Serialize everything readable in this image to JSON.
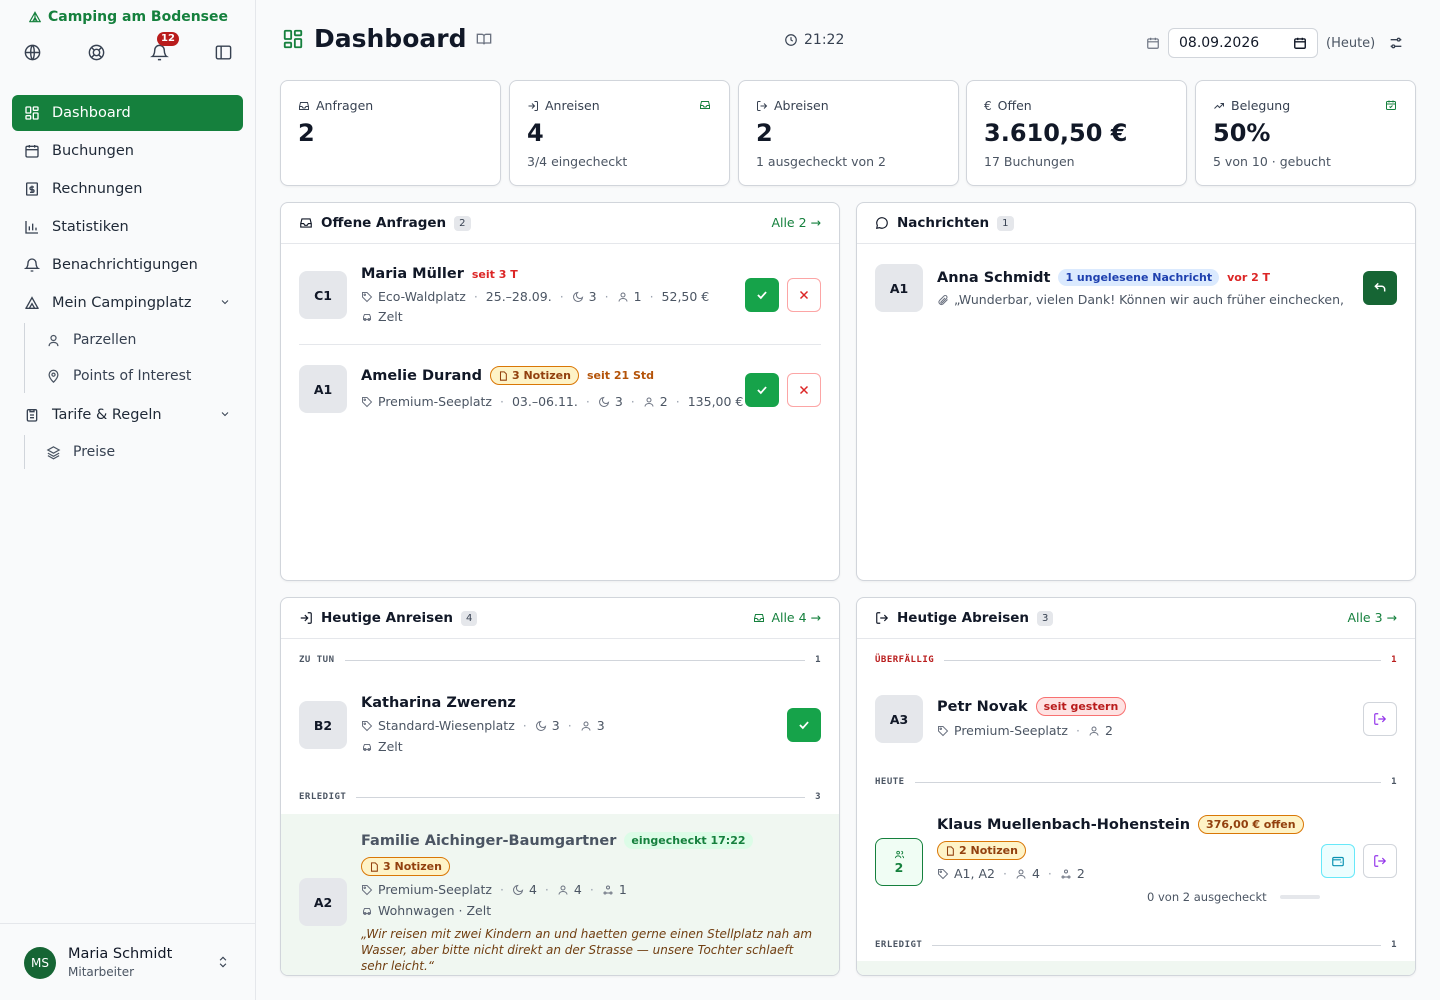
{
  "sidebar": {
    "brand": "Camping am Bodensee",
    "notifications_count": "12",
    "nav": {
      "dashboard": "Dashboard",
      "buchungen": "Buchungen",
      "rechnungen": "Rechnungen",
      "statistiken": "Statistiken",
      "benachrichtigungen": "Benachrichtigungen",
      "campingplatz": "Mein Campingplatz",
      "parzellen": "Parzellen",
      "poi": "Points of Interest",
      "tarife": "Tarife & Regeln",
      "preise": "Preise"
    },
    "user": {
      "initials": "MS",
      "name": "Maria Schmidt",
      "role": "Mitarbeiter"
    }
  },
  "header": {
    "title": "Dashboard",
    "time": "21:22",
    "date": "08.09.2026",
    "today": "(Heute)"
  },
  "stats": {
    "anfragen": {
      "label": "Anfragen",
      "value": "2"
    },
    "anreisen": {
      "label": "Anreisen",
      "value": "4",
      "sub": "3/4 eingecheckt"
    },
    "abreisen": {
      "label": "Abreisen",
      "value": "2",
      "sub": "1 ausgecheckt von 2"
    },
    "offen": {
      "label": "Offen",
      "value": "3.610,50 €",
      "sub": "17 Buchungen"
    },
    "belegung": {
      "label": "Belegung",
      "value": "50%",
      "sub": "5 von 10 · gebucht"
    }
  },
  "anfragen": {
    "title": "Offene Anfragen",
    "count": "2",
    "all": "Alle 2 →",
    "items": [
      {
        "code": "C1",
        "name": "Maria Müller",
        "since": "seit 3 T",
        "pitch": "Eco-Waldplatz",
        "dates": "25.–28.09.",
        "nights": "3",
        "persons": "1",
        "price": "52,50 €",
        "vehicle": "Zelt"
      },
      {
        "code": "A1",
        "name": "Amelie Durand",
        "notes": "3 Notizen",
        "since": "seit 21 Std",
        "pitch": "Premium-Seeplatz",
        "dates": "03.–06.11.",
        "nights": "3",
        "persons": "2",
        "price": "135,00 €"
      }
    ]
  },
  "nachrichten": {
    "title": "Nachrichten",
    "count": "1",
    "items": [
      {
        "code": "A1",
        "name": "Anna Schmidt",
        "unread": "1 ungelesene Nachricht",
        "ago": "vor 2 T",
        "preview": "„Wunderbar, vielen Dank! Können wir auch früher einchecken, ..."
      }
    ]
  },
  "anreisen": {
    "title": "Heutige Anreisen",
    "count": "4",
    "all": "Alle 4 →",
    "todo_label": "ZU TUN",
    "todo_count": "1",
    "done_label": "ERLEDIGT",
    "done_count": "3",
    "todo": {
      "code": "B2",
      "name": "Katharina Zwerenz",
      "pitch": "Standard-Wiesenplatz",
      "nights": "3",
      "persons": "3",
      "vehicle": "Zelt"
    },
    "done": {
      "code": "A2",
      "name": "Familie Aichinger-Baumgartner",
      "checked": "eingecheckt 17:22",
      "notes": "3 Notizen",
      "pitch": "Premium-Seeplatz",
      "nights": "4",
      "persons": "4",
      "children": "1",
      "vehicle": "Wohnwagen · Zelt",
      "quote": "„Wir reisen mit zwei Kindern an und haetten gerne einen Stellplatz nah am Wasser, aber bitte nicht direkt an der Strasse — unsere Tochter schlaeft sehr leicht.“"
    }
  },
  "abreisen": {
    "title": "Heutige Abreisen",
    "count": "3",
    "all": "Alle 3 →",
    "overdue_label": "ÜBERFÄLLIG",
    "overdue_count": "1",
    "today_label": "HEUTE",
    "today_count": "1",
    "done_label": "ERLEDIGT",
    "done_count": "1",
    "overdue": {
      "code": "A3",
      "name": "Petr Novak",
      "since": "seit gestern",
      "pitch": "Premium-Seeplatz",
      "persons": "2"
    },
    "today": {
      "code": "2",
      "name": "Klaus Muellenbach-Hohenstein",
      "open": "376,00 € offen",
      "notes": "2 Notizen",
      "pitch": "A1, A2",
      "persons": "4",
      "children": "2",
      "progress": "0 von 2 ausgecheckt"
    }
  }
}
